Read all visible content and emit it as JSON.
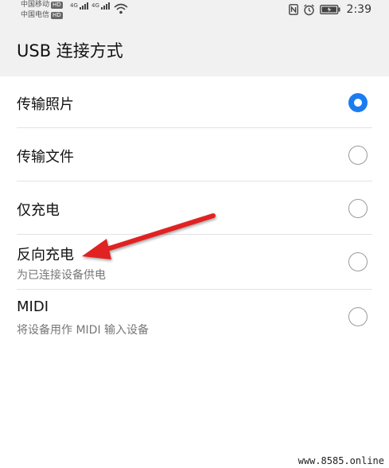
{
  "status_bar": {
    "carrier1": "中国移动",
    "carrier2": "中国电信",
    "hd": "HD",
    "network": "4G",
    "time": "2:39",
    "icons": [
      "nfc-icon",
      "alarm-icon",
      "battery-icon",
      "wifi-icon",
      "signal-icon"
    ]
  },
  "header": {
    "title": "USB 连接方式"
  },
  "options": [
    {
      "label": "传输照片",
      "selected": true
    },
    {
      "label": "传输文件",
      "selected": false
    },
    {
      "label": "仅充电",
      "selected": false
    },
    {
      "label": "反向充电",
      "subtitle": "为已连接设备供电",
      "selected": false
    },
    {
      "label": "MIDI",
      "subtitle": "将设备用作 MIDI 输入设备",
      "selected": false
    }
  ],
  "colors": {
    "accent": "#1b7cf0",
    "annotation_arrow": "#e02020"
  },
  "watermark": "www.8585.online"
}
